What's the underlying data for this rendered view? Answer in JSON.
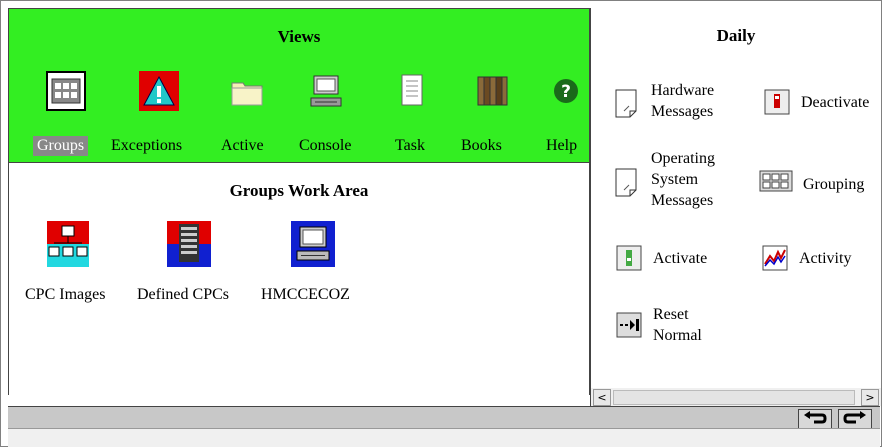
{
  "views": {
    "title": "Views",
    "items": [
      {
        "label": "Groups",
        "icon": "groups-icon",
        "selected": true
      },
      {
        "label": "Exceptions",
        "icon": "exceptions-icon"
      },
      {
        "label": "Active",
        "icon": "folder-icon"
      },
      {
        "label": "Console",
        "icon": "console-icon"
      },
      {
        "label": "Task",
        "icon": "task-icon"
      },
      {
        "label": "Books",
        "icon": "books-icon"
      },
      {
        "label": "Help",
        "icon": "help-icon"
      }
    ]
  },
  "work_area": {
    "title": "Groups Work Area",
    "items": [
      {
        "label": "CPC Images",
        "icon": "cpc-images-icon"
      },
      {
        "label": "Defined CPCs",
        "icon": "defined-cpcs-icon"
      },
      {
        "label": "HMCCECOZ",
        "icon": "hmc-console-icon"
      }
    ]
  },
  "daily": {
    "title": "Daily",
    "tasks": [
      {
        "line1": "Hardware",
        "line2": "Messages",
        "line3": ""
      },
      {
        "line1": "Deactivate",
        "line2": "",
        "line3": ""
      },
      {
        "line1": "Operating",
        "line2": "System",
        "line3": "Messages"
      },
      {
        "line1": "Grouping",
        "line2": "",
        "line3": ""
      },
      {
        "line1": "Activate",
        "line2": "",
        "line3": ""
      },
      {
        "line1": "Activity",
        "line2": "",
        "line3": ""
      },
      {
        "line1": "Reset",
        "line2": "Normal",
        "line3": ""
      }
    ]
  },
  "scrollbar": {
    "left": "<",
    "right": ">"
  },
  "colors": {
    "views_bg": "#33ee22",
    "selected_bg": "#888888",
    "status_bg": "#c8c8c8"
  }
}
